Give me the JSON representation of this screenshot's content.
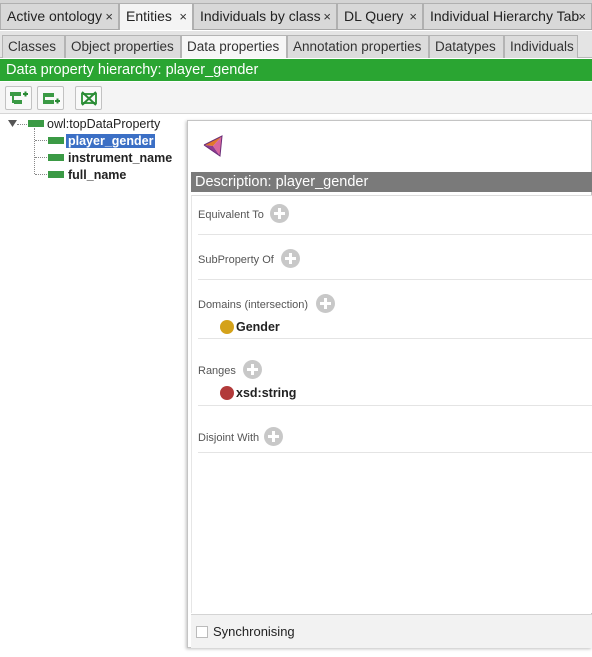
{
  "top_tabs": [
    {
      "label": "Active ontology",
      "close": "×"
    },
    {
      "label": "Entities",
      "close": "×"
    },
    {
      "label": "Individuals by class",
      "close": "×"
    },
    {
      "label": "DL Query",
      "close": "×"
    },
    {
      "label": "Individual Hierarchy Tab",
      "close": "×"
    }
  ],
  "sub_tabs": [
    "Classes",
    "Object properties",
    "Data properties",
    "Annotation properties",
    "Datatypes",
    "Individuals"
  ],
  "hierarchy_header": "Data property hierarchy: player_gender",
  "tree": {
    "root": "owl:topDataProperty",
    "children": [
      "player_gender",
      "instrument_name",
      "full_name"
    ]
  },
  "description": {
    "header": "Description: player_gender",
    "sections": {
      "equivalent": "Equivalent To",
      "subproperty": "SubProperty Of",
      "domains": "Domains (intersection)",
      "ranges": "Ranges",
      "disjoint": "Disjoint With"
    },
    "domain_value": "Gender",
    "range_value": "xsd:string"
  },
  "sync_label": "Synchronising",
  "colors": {
    "green_header": "#2aa532",
    "selection": "#3b6fc5",
    "class_dot": "#d4a21a",
    "datatype_dot": "#b23a3a",
    "description_header": "#7a7a7a"
  }
}
